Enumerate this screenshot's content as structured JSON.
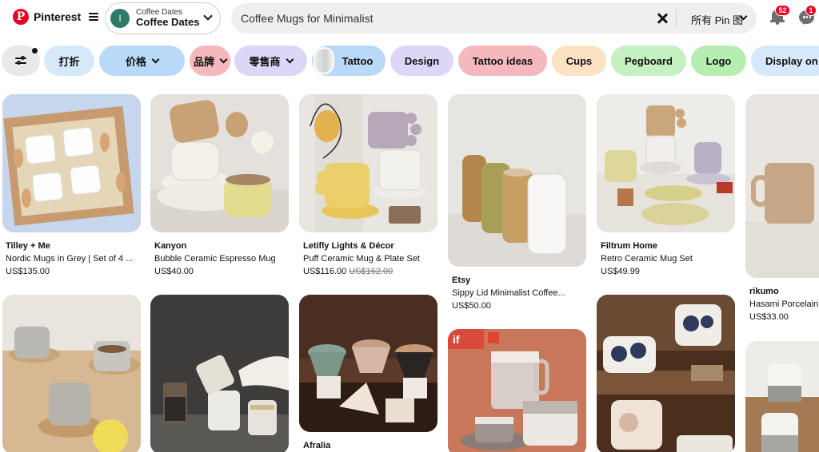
{
  "header": {
    "logo_text": "Pinterest",
    "logo_letter": "P",
    "board": {
      "avatar_letter": "I",
      "subtitle": "Coffee Dates",
      "title": "Coffee Dates"
    },
    "search": {
      "value": "Coffee Mugs for Minimalist",
      "scope_label": "所有 Pin 图"
    },
    "notifications_count": "52",
    "messages_count": "1"
  },
  "filters": {
    "chips": [
      {
        "label": "打折",
        "color": "#d6e9fb"
      },
      {
        "label": "价格",
        "color": "#b8d9f8"
      },
      {
        "label": "品牌",
        "color": "#f4b8bd"
      },
      {
        "label": "零售商",
        "color": "#dcd6f7"
      },
      {
        "label": "Tattoo",
        "color": "#b8d9f8"
      },
      {
        "label": "Design",
        "color": "#dcd6f7"
      },
      {
        "label": "Tattoo ideas",
        "color": "#f4b8bd"
      },
      {
        "label": "Cups",
        "color": "#fbe2c2"
      },
      {
        "label": "Pegboard",
        "color": "#c5f0c2"
      },
      {
        "label": "Logo",
        "color": "#b6eeb1"
      },
      {
        "label": "Display on e",
        "color": "#d6e9fb"
      }
    ]
  },
  "pins": [
    {
      "brand": "Tilley + Me",
      "title": "Nordic Mugs in Grey | Set of 4 ...",
      "price": "US$135.00",
      "old_price": ""
    },
    {
      "brand": "Kanyon",
      "title": "Bubble Ceramic Espresso Mug",
      "price": "US$40.00",
      "old_price": ""
    },
    {
      "brand": "Letifly Lights & Décor",
      "title": "Puff Ceramic Mug & Plate Set",
      "price": "US$116.00",
      "old_price": "US$162.00"
    },
    {
      "brand": "Etsy",
      "title": "Sippy Lid Minimalist Coffee...",
      "price": "US$50.00",
      "old_price": ""
    },
    {
      "brand": "Filtrum Home",
      "title": "Retro Ceramic Mug Set",
      "price": "US$49.99",
      "old_price": ""
    },
    {
      "brand": "rikumo",
      "title": "Hasami Porcelain",
      "price": "US$33.00",
      "old_price": ""
    },
    {
      "brand": "Afralia",
      "title": "",
      "price": "",
      "old_price": ""
    }
  ],
  "award_badge_text": "if",
  "colors": {
    "brand_red": "#e60023"
  }
}
